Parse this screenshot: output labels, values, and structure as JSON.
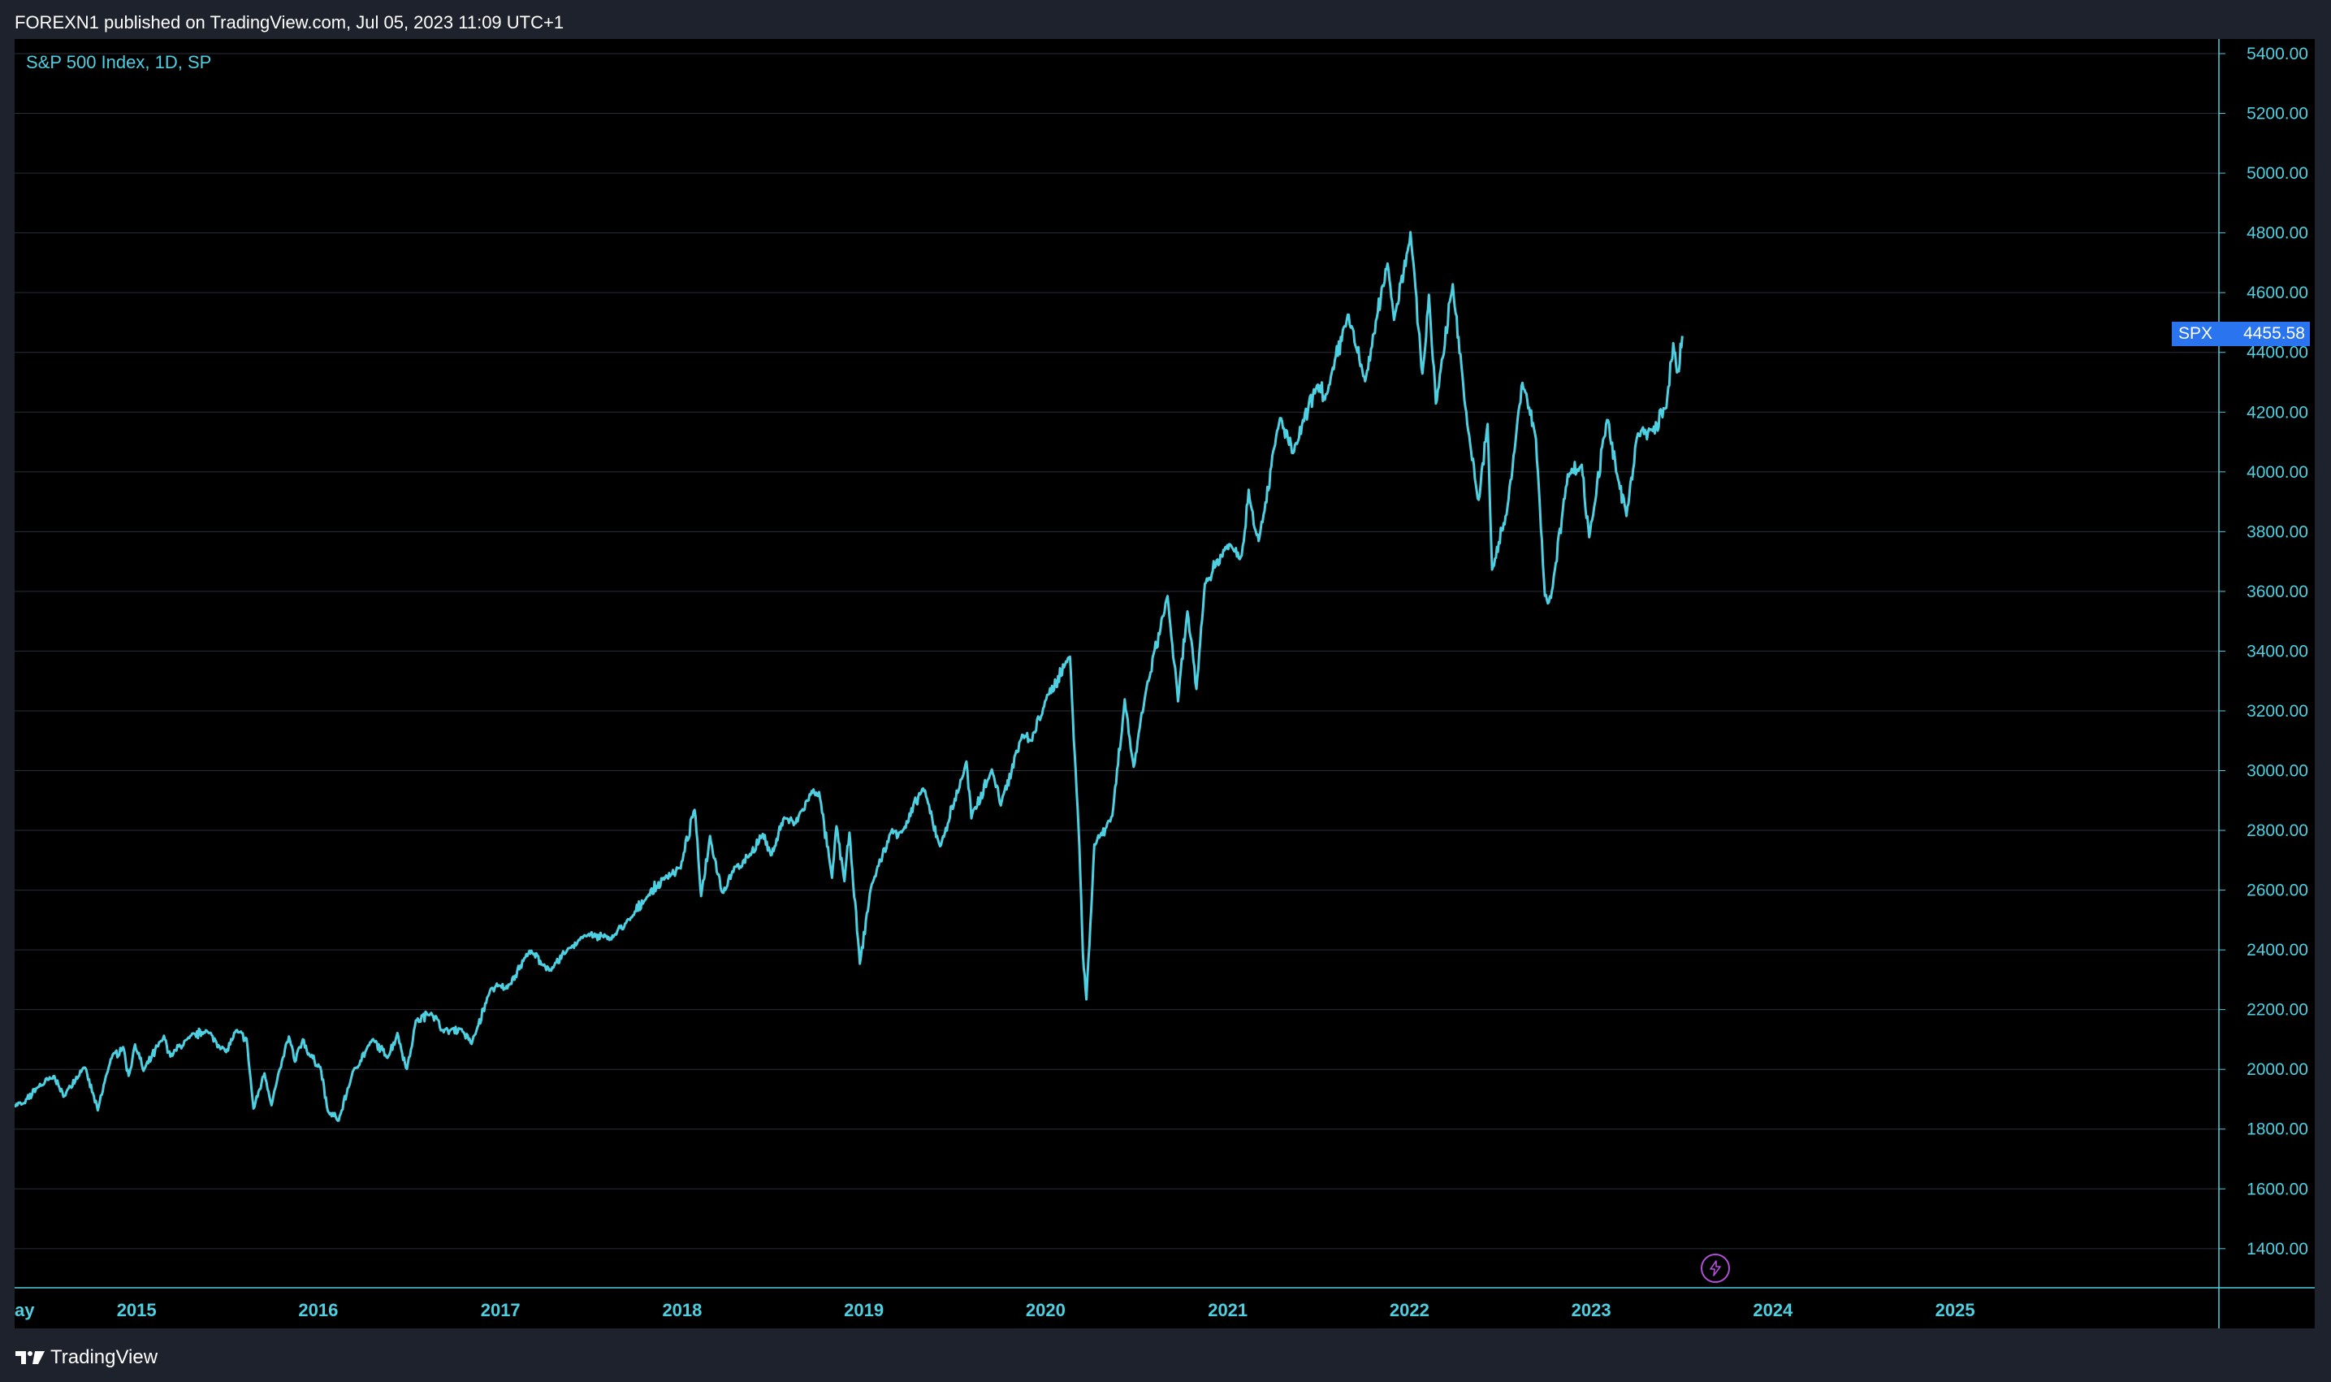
{
  "header": {
    "published_text": "FOREXN1 published on TradingView.com, Jul 05, 2023 11:09 UTC+1"
  },
  "legend": {
    "title": "S&P 500 Index, 1D, SP"
  },
  "price_tag": {
    "symbol": "SPX",
    "value": "4455.58"
  },
  "footer": {
    "logo_text": "TradingView"
  },
  "colors": {
    "line": "#4dd0e1",
    "background": "#000000",
    "frame": "#1e222d",
    "price_tag": "#2a74f0",
    "grid": "#2a2e39",
    "axis_text": "#4dd0e1"
  },
  "icons": {
    "logo": "tradingview-logo-icon",
    "bolt": "lightning-bolt-icon"
  },
  "chart_data": {
    "type": "line",
    "grid": true,
    "y_axis_side": "right",
    "ylim": [
      1269,
      5449
    ],
    "xlim": [
      "2014-05-01",
      "2026-06-15"
    ],
    "y_ticks": [
      "1400.00",
      "1600.00",
      "1800.00",
      "2000.00",
      "2200.00",
      "2400.00",
      "2600.00",
      "2800.00",
      "3000.00",
      "3200.00",
      "3400.00",
      "3600.00",
      "3800.00",
      "4000.00",
      "4200.00",
      "4400.00",
      "4600.00",
      "4800.00",
      "5000.00",
      "5200.00",
      "5400.00"
    ],
    "x_ticks": [
      {
        "date": "2014-05-15",
        "label": "ay"
      },
      {
        "date": "2015-01-01",
        "label": "2015"
      },
      {
        "date": "2016-01-01",
        "label": "2016"
      },
      {
        "date": "2017-01-01",
        "label": "2017"
      },
      {
        "date": "2018-01-01",
        "label": "2018"
      },
      {
        "date": "2019-01-01",
        "label": "2019"
      },
      {
        "date": "2020-01-01",
        "label": "2020"
      },
      {
        "date": "2021-01-01",
        "label": "2021"
      },
      {
        "date": "2022-01-01",
        "label": "2022"
      },
      {
        "date": "2023-01-01",
        "label": "2023"
      },
      {
        "date": "2024-01-01",
        "label": "2024"
      },
      {
        "date": "2025-01-01",
        "label": "2025"
      }
    ],
    "series": [
      {
        "points": [
          [
            "2014-05-01",
            1880
          ],
          [
            "2014-05-20",
            1885
          ],
          [
            "2014-06-15",
            1940
          ],
          [
            "2014-07-20",
            1975
          ],
          [
            "2014-08-07",
            1910
          ],
          [
            "2014-09-18",
            2010
          ],
          [
            "2014-10-15",
            1865
          ],
          [
            "2014-11-10",
            2035
          ],
          [
            "2014-12-05",
            2075
          ],
          [
            "2014-12-16",
            1975
          ],
          [
            "2014-12-29",
            2085
          ],
          [
            "2015-01-15",
            1995
          ],
          [
            "2015-02-25",
            2110
          ],
          [
            "2015-03-10",
            2045
          ],
          [
            "2015-04-15",
            2105
          ],
          [
            "2015-05-20",
            2130
          ],
          [
            "2015-06-30",
            2060
          ],
          [
            "2015-07-20",
            2128
          ],
          [
            "2015-08-10",
            2100
          ],
          [
            "2015-08-24",
            1867
          ],
          [
            "2015-09-15",
            1990
          ],
          [
            "2015-09-29",
            1882
          ],
          [
            "2015-10-20",
            2025
          ],
          [
            "2015-11-03",
            2110
          ],
          [
            "2015-11-15",
            2025
          ],
          [
            "2015-12-01",
            2100
          ],
          [
            "2015-12-15",
            2045
          ],
          [
            "2016-01-05",
            2010
          ],
          [
            "2016-01-20",
            1860
          ],
          [
            "2016-02-11",
            1829
          ],
          [
            "2016-03-10",
            1990
          ],
          [
            "2016-04-20",
            2100
          ],
          [
            "2016-05-19",
            2040
          ],
          [
            "2016-06-08",
            2118
          ],
          [
            "2016-06-27",
            2000
          ],
          [
            "2016-07-15",
            2160
          ],
          [
            "2016-08-15",
            2190
          ],
          [
            "2016-09-09",
            2128
          ],
          [
            "2016-10-15",
            2135
          ],
          [
            "2016-11-04",
            2085
          ],
          [
            "2016-12-13",
            2271
          ],
          [
            "2017-01-15",
            2275
          ],
          [
            "2017-02-28",
            2395
          ],
          [
            "2017-04-13",
            2330
          ],
          [
            "2017-05-15",
            2400
          ],
          [
            "2017-06-19",
            2450
          ],
          [
            "2017-08-10",
            2438
          ],
          [
            "2017-09-20",
            2505
          ],
          [
            "2017-10-20",
            2575
          ],
          [
            "2017-11-30",
            2645
          ],
          [
            "2017-12-29",
            2675
          ],
          [
            "2018-01-26",
            2873
          ],
          [
            "2018-02-08",
            2581
          ],
          [
            "2018-02-26",
            2780
          ],
          [
            "2018-03-23",
            2588
          ],
          [
            "2018-04-10",
            2655
          ],
          [
            "2018-05-15",
            2715
          ],
          [
            "2018-06-12",
            2785
          ],
          [
            "2018-06-28",
            2715
          ],
          [
            "2018-07-25",
            2845
          ],
          [
            "2018-08-15",
            2820
          ],
          [
            "2018-09-20",
            2930
          ],
          [
            "2018-10-03",
            2925
          ],
          [
            "2018-10-29",
            2641
          ],
          [
            "2018-11-07",
            2814
          ],
          [
            "2018-11-23",
            2633
          ],
          [
            "2018-12-03",
            2790
          ],
          [
            "2018-12-24",
            2351
          ],
          [
            "2019-01-15",
            2610
          ],
          [
            "2019-02-25",
            2795
          ],
          [
            "2019-03-22",
            2800
          ],
          [
            "2019-04-30",
            2945
          ],
          [
            "2019-06-03",
            2744
          ],
          [
            "2019-07-26",
            3025
          ],
          [
            "2019-08-05",
            2845
          ],
          [
            "2019-09-15",
            3005
          ],
          [
            "2019-10-03",
            2888
          ],
          [
            "2019-11-15",
            3120
          ],
          [
            "2019-12-03",
            3095
          ],
          [
            "2019-12-31",
            3230
          ],
          [
            "2020-02-19",
            3386
          ],
          [
            "2020-03-09",
            2747
          ],
          [
            "2020-03-16",
            2386
          ],
          [
            "2020-03-23",
            2237
          ],
          [
            "2020-04-08",
            2750
          ],
          [
            "2020-05-14",
            2850
          ],
          [
            "2020-06-08",
            3232
          ],
          [
            "2020-06-26",
            3010
          ],
          [
            "2020-07-22",
            3275
          ],
          [
            "2020-09-02",
            3580
          ],
          [
            "2020-09-23",
            3237
          ],
          [
            "2020-10-12",
            3535
          ],
          [
            "2020-10-30",
            3270
          ],
          [
            "2020-11-16",
            3625
          ],
          [
            "2020-12-31",
            3756
          ],
          [
            "2021-01-29",
            3715
          ],
          [
            "2021-02-12",
            3935
          ],
          [
            "2021-03-04",
            3768
          ],
          [
            "2021-04-16",
            4185
          ],
          [
            "2021-05-12",
            4063
          ],
          [
            "2021-06-29",
            4290
          ],
          [
            "2021-07-19",
            4258
          ],
          [
            "2021-08-30",
            4528
          ],
          [
            "2021-10-04",
            4300
          ],
          [
            "2021-11-18",
            4705
          ],
          [
            "2021-12-01",
            4513
          ],
          [
            "2022-01-03",
            4796
          ],
          [
            "2022-01-27",
            4326
          ],
          [
            "2022-02-09",
            4587
          ],
          [
            "2022-02-23",
            4225
          ],
          [
            "2022-03-29",
            4631
          ],
          [
            "2022-04-29",
            4131
          ],
          [
            "2022-05-20",
            3901
          ],
          [
            "2022-06-07",
            4160
          ],
          [
            "2022-06-16",
            3666
          ],
          [
            "2022-07-15",
            3863
          ],
          [
            "2022-08-16",
            4305
          ],
          [
            "2022-09-12",
            4110
          ],
          [
            "2022-09-30",
            3585
          ],
          [
            "2022-10-12",
            3577
          ],
          [
            "2022-11-15",
            3991
          ],
          [
            "2022-12-13",
            4019
          ],
          [
            "2022-12-28",
            3783
          ],
          [
            "2023-02-02",
            4179
          ],
          [
            "2023-02-24",
            3970
          ],
          [
            "2023-03-13",
            3855
          ],
          [
            "2023-04-03",
            4124
          ],
          [
            "2023-05-05",
            4136
          ],
          [
            "2023-06-01",
            4221
          ],
          [
            "2023-06-15",
            4426
          ],
          [
            "2023-06-26",
            4328
          ],
          [
            "2023-07-03",
            4455
          ]
        ]
      }
    ]
  }
}
